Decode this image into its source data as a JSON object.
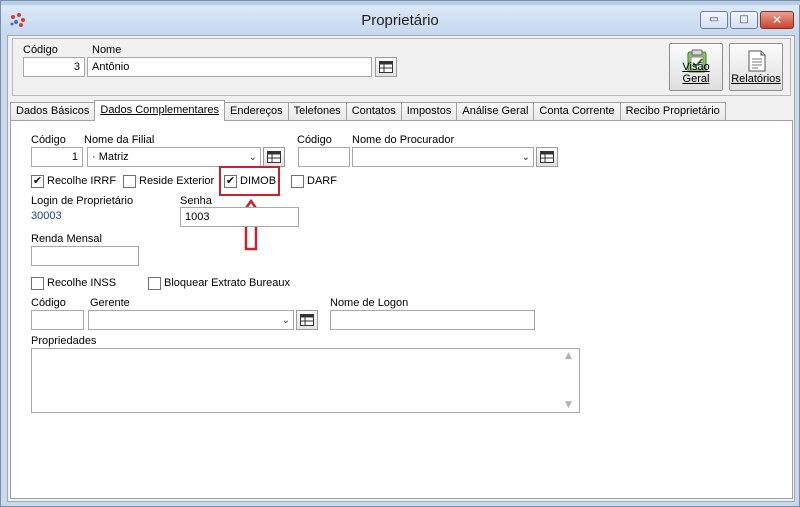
{
  "window": {
    "title": "Proprietário",
    "controls": {
      "minimize": "▭",
      "maximize": "□",
      "close": "✕"
    }
  },
  "header": {
    "codigo_label": "Código",
    "codigo_value": "3",
    "nome_label": "Nome",
    "nome_value": "Antônio",
    "visao_geral_label": "Visão Geral",
    "relatorios_label": "Relatórios"
  },
  "tabs": [
    {
      "label": "Dados Básicos",
      "active": false
    },
    {
      "label": "Dados Complementares",
      "active": true
    },
    {
      "label": "Endereços",
      "active": false
    },
    {
      "label": "Telefones",
      "active": false
    },
    {
      "label": "Contatos",
      "active": false
    },
    {
      "label": "Impostos",
      "active": false
    },
    {
      "label": "Análise Geral",
      "active": false
    },
    {
      "label": "Conta Corrente",
      "active": false
    },
    {
      "label": "Recibo Proprietário",
      "active": false
    }
  ],
  "form": {
    "filial": {
      "codigo_label": "Código",
      "codigo_value": "1",
      "nome_label": "Nome da Filial",
      "nome_value": "· Matriz"
    },
    "procurador": {
      "codigo_label": "Código",
      "codigo_value": "",
      "nome_label": "Nome do Procurador",
      "nome_value": ""
    },
    "checkboxes": {
      "recolhe_irrf": {
        "label": "Recolhe IRRF",
        "checked": true
      },
      "reside_exterior": {
        "label": "Reside Exterior",
        "checked": false
      },
      "dimob": {
        "label": "DIMOB",
        "checked": true
      },
      "darf": {
        "label": "DARF",
        "checked": false
      },
      "recolhe_inss": {
        "label": "Recolhe INSS",
        "checked": false
      },
      "bloquear_extrato": {
        "label": "Bloquear Extrato Bureaux",
        "checked": false
      }
    },
    "login": {
      "label": "Login de Proprietário",
      "value": "30003"
    },
    "senha": {
      "label": "Senha",
      "value": "1003"
    },
    "renda": {
      "label": "Renda Mensal",
      "value": ""
    },
    "gerente": {
      "codigo_label": "Código",
      "codigo_value": "",
      "nome_label": "Gerente",
      "nome_value": ""
    },
    "logon": {
      "label": "Nome de Logon",
      "value": ""
    },
    "propriedades": {
      "label": "Propriedades",
      "value": ""
    }
  },
  "colors": {
    "highlight": "#c8232c",
    "link_value": "#1a3fa8",
    "title_bar": "#c9daec"
  }
}
